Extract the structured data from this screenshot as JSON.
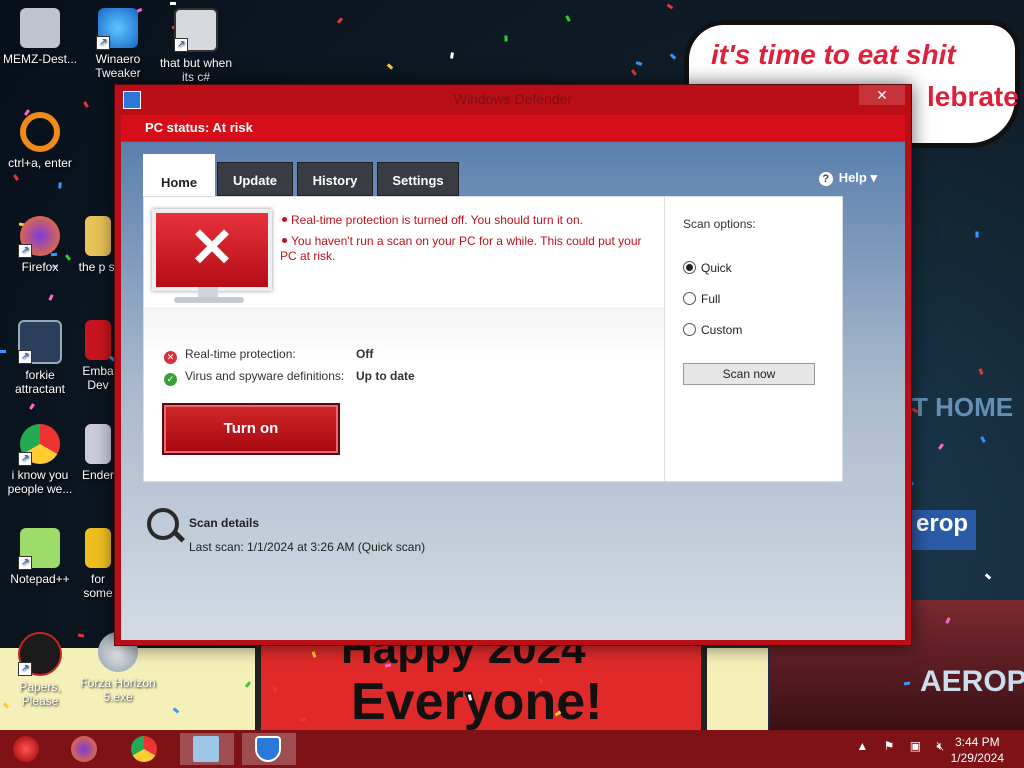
{
  "desktop": {
    "icons": [
      {
        "label": "MEMZ-Dest...",
        "icon": "recycle-bin-icon"
      },
      {
        "label": "Winaero Tweaker",
        "icon": "winaero-tweaker-icon"
      },
      {
        "label": "that but when its c#",
        "icon": "window-stack-icon"
      },
      {
        "label": "ctrl+a, enter",
        "icon": "ring-icon"
      },
      {
        "label": "Firefox",
        "icon": "firefox-icon"
      },
      {
        "label": "the p sl",
        "icon": "folder-icon"
      },
      {
        "label": "forkie attractant",
        "icon": "gear-monitor-icon"
      },
      {
        "label": "Emba Dev",
        "icon": "embarcadero-icon"
      },
      {
        "label": "i know you people we...",
        "icon": "chrome-icon"
      },
      {
        "label": "Ender",
        "icon": "ender-icon"
      },
      {
        "label": "Notepad++",
        "icon": "notepad-plus-plus-icon"
      },
      {
        "label": "for some",
        "icon": "app-icon"
      },
      {
        "label": "Papers, Please",
        "icon": "papers-please-icon"
      },
      {
        "label": "Forza Horizon 5.exe",
        "icon": "flash-icon"
      }
    ],
    "wallpaper_bubble_line1": "it's time to eat shit",
    "wallpaper_bubble_line2": "lebrate",
    "poster_line1": "Happy 2024",
    "poster_line2": "Everyone!",
    "side_sign_1": "T HOME",
    "side_sign_2": "erop",
    "side_sign_3": "AEROPOS"
  },
  "window": {
    "title": "Windows Defender",
    "close_label": "✕",
    "status": "PC status: At risk",
    "tabs": [
      "Home",
      "Update",
      "History",
      "Settings"
    ],
    "active_tab": "Home",
    "help_label": "Help ▾",
    "alerts": [
      "Real-time protection is turned off. You should turn it on.",
      "You haven't run a scan on your PC for a while. This could put your PC at risk."
    ],
    "rows": [
      {
        "label": "Real-time protection:",
        "value": "Off",
        "status": "bad"
      },
      {
        "label": "Virus and spyware definitions:",
        "value": "Up to date",
        "status": "good"
      }
    ],
    "turn_on_label": "Turn on",
    "scan_options_title": "Scan options:",
    "scan_options": [
      "Quick",
      "Full",
      "Custom"
    ],
    "selected_scan_option": "Quick",
    "scan_now_label": "Scan now",
    "scan_details_title": "Scan details",
    "last_scan": "Last scan:  1/1/2024 at 3:26 AM (Quick scan)"
  },
  "taskbar": {
    "apps": [
      "start-orb-icon",
      "firefox-icon",
      "chrome-icon",
      "control-panel-icon",
      "defender-icon"
    ],
    "active_app": "defender-icon",
    "clock_time": "3:44 PM",
    "clock_date": "1/29/2024",
    "colors": {
      "taskbar": "#7e1216",
      "accent_red": "#d60e1a"
    }
  }
}
